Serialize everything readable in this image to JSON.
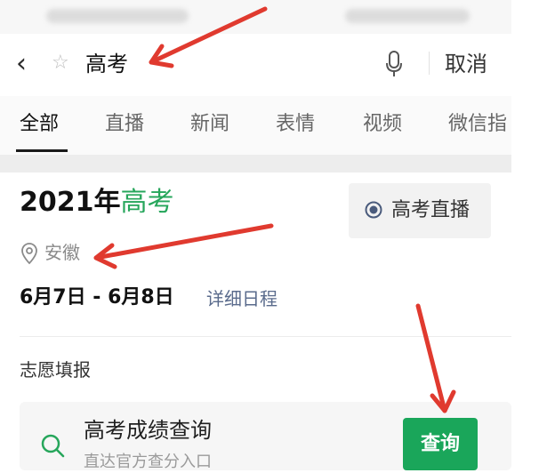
{
  "search": {
    "query": "高考",
    "cancel": "取消"
  },
  "tabs": [
    "全部",
    "直播",
    "新闻",
    "表情",
    "视频",
    "微信指"
  ],
  "card": {
    "year_prefix": "2021年",
    "year_keyword": "高考",
    "live_label": "高考直播",
    "location": "安徽",
    "dates": "6月7日 - 6月8日",
    "schedule_link": "详细日程",
    "section_title": "志愿填报",
    "result": {
      "title": "高考成绩查询",
      "subtitle": "直达官方查分入口",
      "button": "查询"
    }
  },
  "icons": [
    "back-arrow-icon",
    "star-icon",
    "microphone-icon",
    "radio-live-icon",
    "location-pin-icon",
    "search-icon"
  ],
  "colors": {
    "accent_green": "#26a65b",
    "button_green": "#1aa65a",
    "annotation_red": "#e03a2f",
    "link_blue_gray": "#5a6b8c"
  }
}
